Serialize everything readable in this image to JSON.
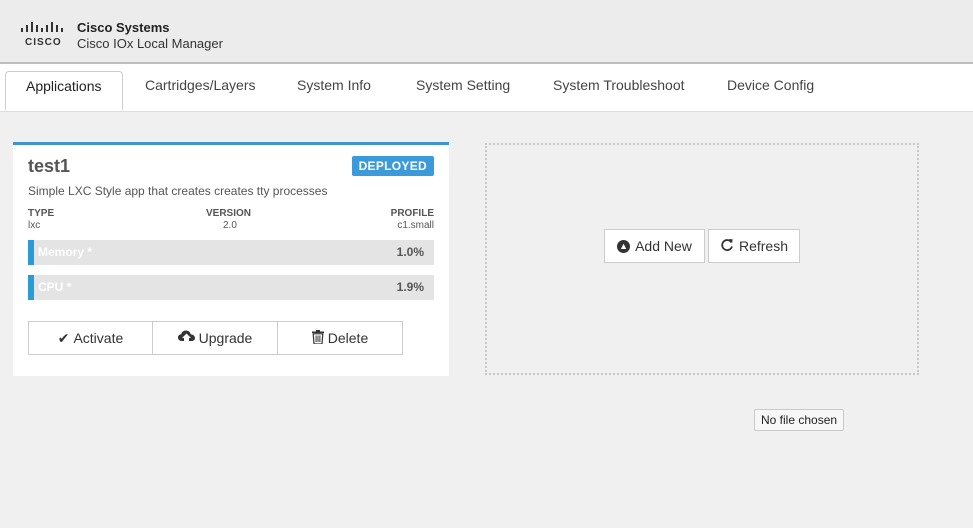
{
  "header": {
    "logo_word": "cisco",
    "company": "Cisco Systems",
    "product": "Cisco IOx Local Manager"
  },
  "tabs": [
    {
      "label": "Applications",
      "active": true
    },
    {
      "label": "Cartridges/Layers"
    },
    {
      "label": "System Info"
    },
    {
      "label": "System Setting"
    },
    {
      "label": "System Troubleshoot"
    },
    {
      "label": "Device Config"
    }
  ],
  "app_card": {
    "name": "test1",
    "status": "DEPLOYED",
    "status_color": "#3b9ad9",
    "accent_color": "#3d94d0",
    "description": "Simple LXC Style app that creates creates tty processes",
    "type_label": "TYPE",
    "type_value": "lxc",
    "version_label": "VERSION",
    "version_value": "2.0",
    "profile_label": "PROFILE",
    "profile_value": "c1.small",
    "memory": {
      "label": "Memory *",
      "value": "1.0%"
    },
    "cpu": {
      "label": "CPU *",
      "value": "1.9%"
    },
    "buttons": {
      "activate": {
        "label": "Activate",
        "icon": "checkmark-icon"
      },
      "upgrade": {
        "label": "Upgrade",
        "icon": "cloud-upload-icon"
      },
      "delete": {
        "label": "Delete",
        "icon": "trash-icon"
      }
    }
  },
  "toolbar": {
    "add_new": {
      "label": "Add New",
      "icon": "circle-arrow-up-icon"
    },
    "refresh": {
      "label": "Refresh",
      "icon": "refresh-icon"
    }
  },
  "file_status": "No file chosen"
}
